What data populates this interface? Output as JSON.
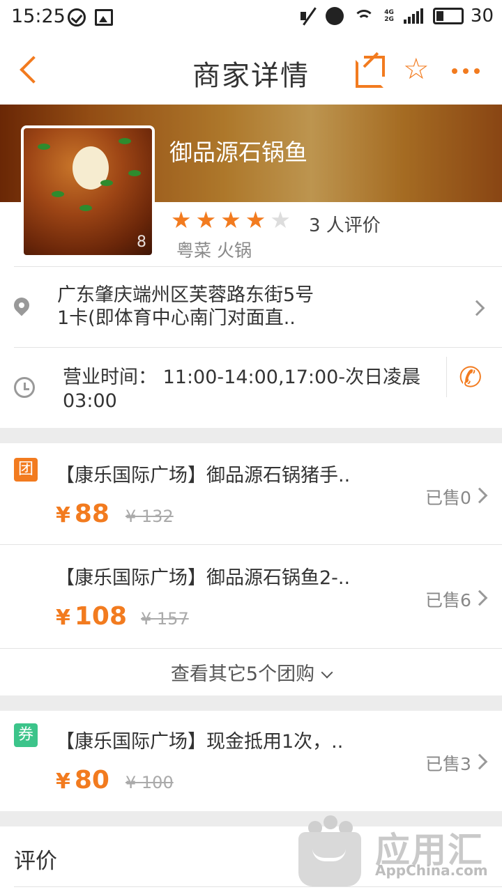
{
  "status_bar": {
    "time": "15:25",
    "battery": "30"
  },
  "header": {
    "title": "商家详情"
  },
  "shop": {
    "name": "御品源石锅鱼",
    "photo_count": "8",
    "rating": 4,
    "rating_max": 5,
    "rating_count_label": "3 人评价",
    "categories": "粤菜 火锅",
    "address_line1": "广东肇庆端州区芙蓉路东街5号",
    "address_line2": "1卡(即体育中心南门对面直..",
    "hours_line1": "营业时间：  11:00-14:00,17:00-次日凌晨",
    "hours_line2": "03:00"
  },
  "deals": [
    {
      "badge": "团",
      "badge_color": "#f27b1f",
      "title": "【康乐国际广场】御品源石锅猪手..",
      "currency": "¥",
      "price": "88",
      "original": "¥ 132",
      "sold": "已售0"
    },
    {
      "badge": "",
      "badge_color": "",
      "title": "【康乐国际广场】御品源石锅鱼2-..",
      "currency": "¥",
      "price": "108",
      "original": "¥ 157",
      "sold": "已售6"
    }
  ],
  "more_deals_label": "查看其它5个团购",
  "vouchers": [
    {
      "badge": "券",
      "badge_color": "#3cc48a",
      "title": "【康乐国际广场】现金抵用1次，..",
      "currency": "¥",
      "price": "80",
      "original": "¥ 100",
      "sold": "已售3"
    }
  ],
  "reviews_label": "评价",
  "watermark": {
    "text": "应用汇",
    "sub": "AppChina.com"
  },
  "colors": {
    "accent": "#f27b1f",
    "star_off": "#dddddd"
  }
}
